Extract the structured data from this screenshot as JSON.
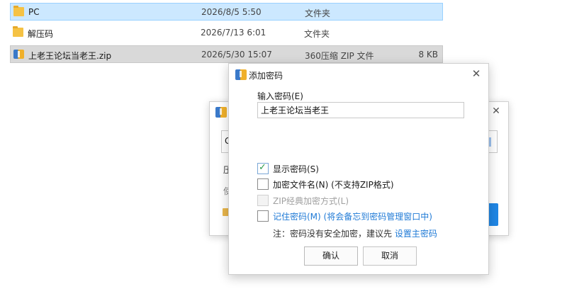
{
  "files": [
    {
      "name": "PC",
      "date": "2026/8/5 5:50",
      "type": "文件夹",
      "size": "",
      "icon": "folder-icon",
      "state": "selected"
    },
    {
      "name": "解压码",
      "date": "2026/7/13 6:01",
      "type": "文件夹",
      "size": "",
      "icon": "folder-icon",
      "state": "normal"
    },
    {
      "name": "上老王论坛当老王.zip",
      "date": "2026/5/30 15:07",
      "type": "360压缩 ZIP 文件",
      "size": "8 KB",
      "icon": "zip-icon",
      "state": "highlight"
    }
  ],
  "bg_dialog": {
    "field_text": "G",
    "line1": "压",
    "line2": "使"
  },
  "dialog": {
    "title": "添加密码",
    "close_glyph": "✕",
    "password_label": "输入密码(E)",
    "password_value": "上老王论坛当老王",
    "options": [
      {
        "label": "显示密码(S)",
        "checked": true,
        "disabled": false,
        "style": "normal"
      },
      {
        "label": "加密文件名(N) (不支持ZIP格式)",
        "checked": false,
        "disabled": false,
        "style": "normal"
      },
      {
        "label": "ZIP经典加密方式(L)",
        "checked": false,
        "disabled": true,
        "style": "disabled"
      },
      {
        "label": "记住密码(M) (将会备忘到密码管理窗口中)",
        "checked": false,
        "disabled": false,
        "style": "link"
      }
    ],
    "note_prefix": "注：密码没有安全加密，建议先 ",
    "note_link": "设置主密码",
    "ok_label": "确认",
    "cancel_label": "取消"
  },
  "colors": {
    "selection": "#cce8ff",
    "highlight": "#d9d9d9",
    "link": "#1f7ad6",
    "check": "#2a9a4a"
  }
}
